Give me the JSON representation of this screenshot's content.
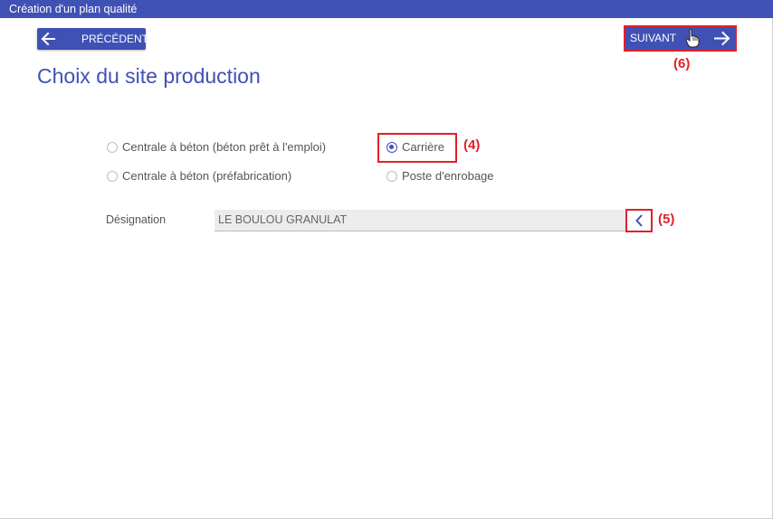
{
  "window": {
    "title": "Création d'un plan qualité"
  },
  "toolbar": {
    "prev_label": "PRÉCÉDENT",
    "next_label": "SUIVANT",
    "next_annotation": "(6)"
  },
  "page": {
    "title": "Choix du site production"
  },
  "site_types": {
    "options": [
      {
        "label": "Centrale à béton (béton prêt à l'emploi)",
        "selected": false
      },
      {
        "label": "Carrière",
        "selected": true,
        "annotation": "(4)"
      },
      {
        "label": "Centrale à béton (préfabrication)",
        "selected": false
      },
      {
        "label": "Poste d'enrobage",
        "selected": false
      }
    ]
  },
  "designation": {
    "label": "Désignation",
    "value": "LE BOULOU GRANULAT",
    "button_annotation": "(5)"
  },
  "icons": {
    "prev": "arrow-left-icon",
    "next": "arrow-right-icon",
    "cursor": "hand-pointer-icon",
    "chevron": "chevron-left-icon"
  },
  "colors": {
    "primary": "#3f51b5",
    "annotation": "#e0202a",
    "field_background": "#ececec"
  }
}
